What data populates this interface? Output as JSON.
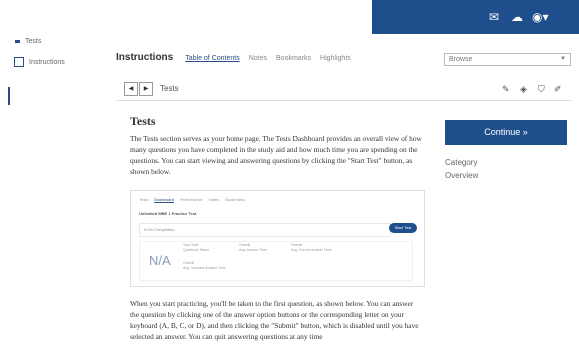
{
  "header": {
    "icons": [
      "mail-icon",
      "cloud-icon",
      "user-menu-icon"
    ],
    "accent": "#1f4e8c"
  },
  "sidebar": {
    "items": [
      {
        "label": "Tests"
      },
      {
        "label": "Instructions"
      }
    ]
  },
  "tabs": {
    "title": "Instructions",
    "items": [
      "Table of Contents",
      "Notes",
      "Bookmarks",
      "Highlights"
    ],
    "active": "Table of Contents"
  },
  "browse": {
    "value": "Browse"
  },
  "nav": {
    "crumb": "Tests"
  },
  "doc": {
    "title": "Tests",
    "para1": "The Tests section serves as your home page. The Tests Dashboard provides an overall view of how many questions you have completed in the study aid and how much time you are spending on the questions. You can start viewing and answering questions by clicking the \"Start Test\" button, as shown below.",
    "para2": "When you start practicing, you'll be taken to the first question, as shown below. You can answer the question by clicking one of the answer option buttons or the corresponding letter on your keyboard (A, B, C, or D), and then clicking the \"Submit\" button, which is disabled until you have selected an answer. You can quit answering questions at any time"
  },
  "figure": {
    "tabs": [
      "Tests",
      "Dashboard",
      "Performance",
      "Notes",
      "Bookmarks"
    ],
    "subtitle": "Unlimited MBE 1 Practice Test",
    "progress": "0.0% Completion",
    "button": "Start Test",
    "na": "N/A",
    "meta1": "Your Total\nQuestions Taken",
    "meta2": "Overall\nAvg. Answer Time",
    "meta3": "Overall\nAvg. Correct Answer Time",
    "meta4": "Overall\nAvg. Incorrect Answer Time"
  },
  "right": {
    "continue": "Continue »",
    "category": "Category",
    "overview": "Overview"
  }
}
